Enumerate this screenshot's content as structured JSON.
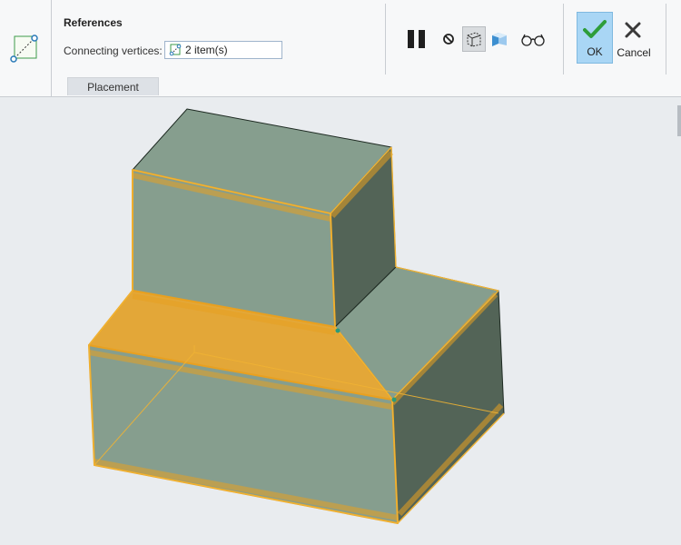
{
  "references": {
    "title": "References",
    "connecting_vertices_label": "Connecting vertices:",
    "connecting_vertices_value": "2 item(s)"
  },
  "tabs": [
    {
      "label": "Placement"
    }
  ],
  "toolbar": {
    "pause_icon": "pause-icon",
    "no_preview_icon": "no-preview-icon",
    "verify_icon": "verify-preview-icon",
    "feature_preview_icon": "feature-preview-icon",
    "glasses_icon": "glasses-icon",
    "ok_label": "OK",
    "cancel_label": "Cancel"
  },
  "colors": {
    "face": "#869e8e",
    "shadow_face": "#536457",
    "selection": "#e8a020",
    "highlight_face": "#e3a738",
    "ok_bg": "#a9d6f5"
  }
}
